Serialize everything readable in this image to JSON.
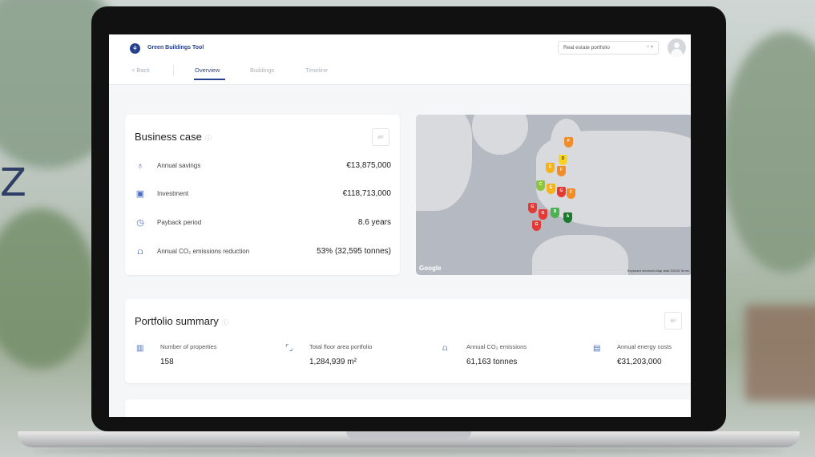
{
  "app": {
    "title": "Green Buildings Tool",
    "portfolio_select": {
      "value": "Real estate portfolio",
      "controls": "× ▾"
    }
  },
  "nav": {
    "back": "< Back",
    "tabs": [
      {
        "label": "Overview",
        "active": true
      },
      {
        "label": "Buildings",
        "active": false
      },
      {
        "label": "Timeline",
        "active": false
      }
    ]
  },
  "business_case": {
    "title": "Business case",
    "unit_label": "m²",
    "rows": [
      {
        "icon": "piggy-bank-icon",
        "label": "Annual savings",
        "value": "€13,875,000"
      },
      {
        "icon": "money-icon",
        "label": "Investment",
        "value": "€118,713,000"
      },
      {
        "icon": "clock-icon",
        "label": "Payback period",
        "value": "8.6 years"
      },
      {
        "icon": "co2-icon",
        "label": "Annual CO₂ emissions reduction",
        "value": "53% (32,595 tonnes)"
      }
    ]
  },
  "map": {
    "provider": "Google",
    "credits": "Keyboard shortcuts   Map data ©2025   Terms",
    "pins": [
      {
        "label": "F",
        "color": "#f28c28"
      },
      {
        "label": "E",
        "color": "#f5b21b"
      },
      {
        "label": "D",
        "color": "#f9d423"
      },
      {
        "label": "C",
        "color": "#8cc63f"
      },
      {
        "label": "G",
        "color": "#e53935"
      },
      {
        "label": "A",
        "color": "#1b7a2c"
      },
      {
        "label": "B",
        "color": "#4caf50"
      }
    ]
  },
  "portfolio_summary": {
    "title": "Portfolio summary",
    "unit_label": "m²",
    "items": [
      {
        "icon": "building-icon",
        "label": "Number of properties",
        "value": "158"
      },
      {
        "icon": "floor-area-icon",
        "label": "Total floor area portfolio",
        "value": "1,284,939 m²"
      },
      {
        "icon": "emissions-icon",
        "label": "Annual CO₂ emissions",
        "value": "61,163 tonnes"
      },
      {
        "icon": "bill-icon",
        "label": "Annual energy costs",
        "value": "€31,203,000"
      }
    ]
  },
  "background": {
    "partial_text": "Z"
  }
}
